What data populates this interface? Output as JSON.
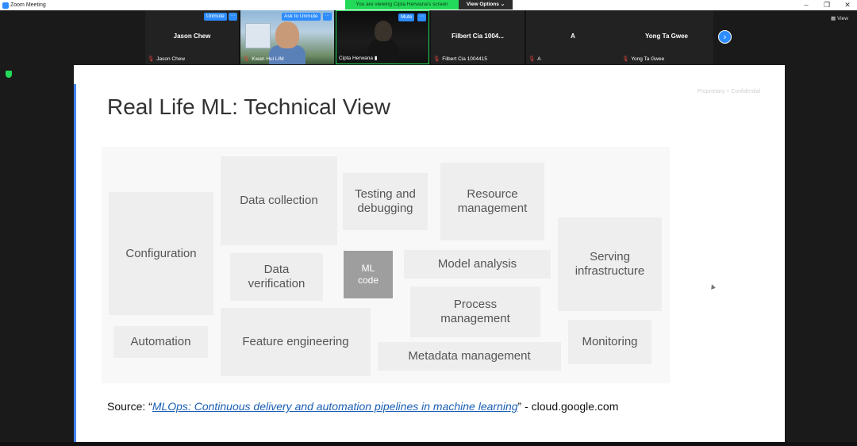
{
  "window": {
    "title": "Zoom Meeting",
    "viewing_banner": "You are viewing Cipta Herwana's screen",
    "view_options": "View Options ⌄",
    "view_label": "View"
  },
  "participants": [
    {
      "display": "Jason Chew",
      "label": "Jason Chew"
    },
    {
      "display": "",
      "label": "Kwan Hui LIM",
      "button": "Ask to Unmute"
    },
    {
      "display": "",
      "label": "Cipta Herwana",
      "button": "Mute"
    },
    {
      "display": "Filbert  Cia  1004...",
      "label": "Filbert Cia 1004415"
    },
    {
      "display": "A",
      "label": "A"
    },
    {
      "display": "Yong Ta Gwee",
      "label": "Yong Ta Gwee"
    }
  ],
  "tile_buttons": {
    "unmute": "Unmute",
    "more": "···"
  },
  "slide": {
    "title": "Real Life ML: Technical View",
    "confidential": "Proprietary + Confidential",
    "boxes": {
      "configuration": "Configuration",
      "data_collection": "Data collection",
      "testing": "Testing and debugging",
      "resource": "Resource management",
      "serving": "Serving infrastructure",
      "data_verification": "Data verification",
      "ml_code": "ML code",
      "model_analysis": "Model analysis",
      "process_management": "Process management",
      "automation": "Automation",
      "feature_engineering": "Feature engineering",
      "metadata": "Metadata management",
      "monitoring": "Monitoring"
    },
    "source_prefix": "Source: “",
    "source_link": "MLOps: Continuous delivery and automation pipelines in machine learning",
    "source_suffix": "” - cloud.google.com"
  }
}
